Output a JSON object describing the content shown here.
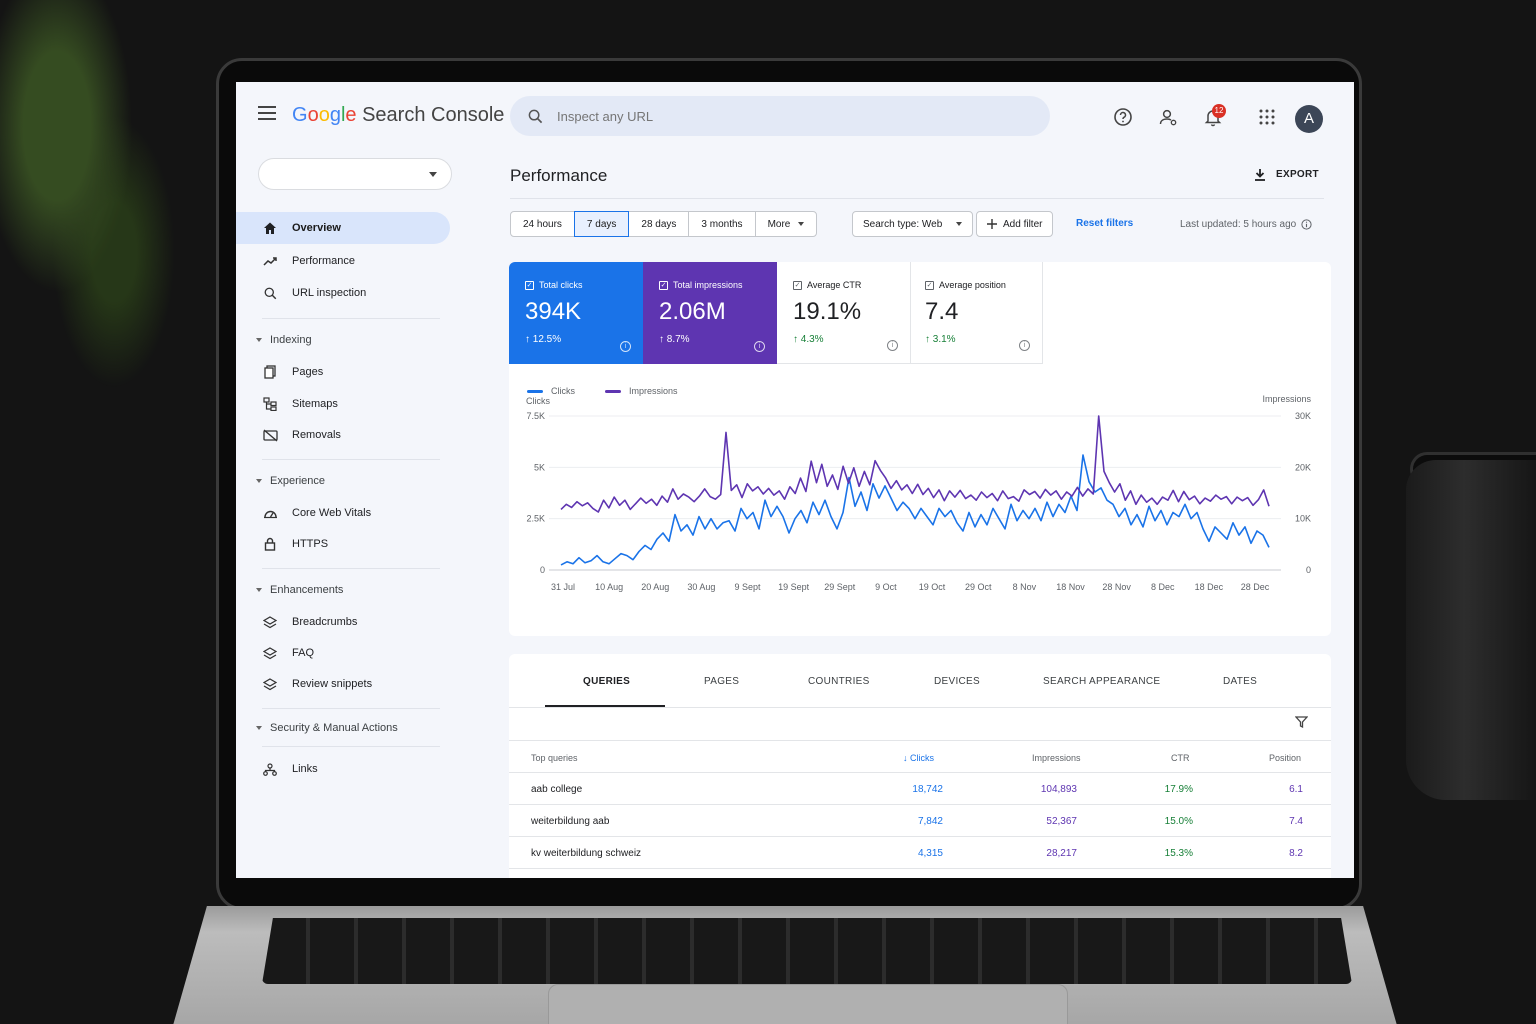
{
  "app": {
    "brand_google": [
      "G",
      "o",
      "o",
      "g",
      "l",
      "e"
    ],
    "brand_product": "Search Console",
    "search_placeholder": "Inspect any URL",
    "notification_count": "12",
    "avatar_letter": "A"
  },
  "sidebar": {
    "items": [
      {
        "label": "Overview",
        "icon": "home-icon",
        "active": true
      },
      {
        "label": "Performance",
        "icon": "trend-icon"
      },
      {
        "label": "URL inspection",
        "icon": "search-icon"
      }
    ],
    "sections": [
      {
        "title": "Indexing",
        "items": [
          {
            "label": "Pages",
            "icon": "pages-icon"
          },
          {
            "label": "Sitemaps",
            "icon": "sitemap-icon"
          },
          {
            "label": "Removals",
            "icon": "removals-icon"
          }
        ]
      },
      {
        "title": "Experience",
        "items": [
          {
            "label": "Core Web Vitals",
            "icon": "gauge-icon"
          },
          {
            "label": "HTTPS",
            "icon": "lock-icon"
          }
        ]
      },
      {
        "title": "Enhancements",
        "items": [
          {
            "label": "Breadcrumbs",
            "icon": "layers-icon"
          },
          {
            "label": "FAQ",
            "icon": "layers-icon"
          },
          {
            "label": "Review snippets",
            "icon": "layers-icon"
          }
        ]
      },
      {
        "title": "Security & Manual Actions",
        "items": []
      }
    ],
    "bottom_items": [
      {
        "label": "Links",
        "icon": "links-icon"
      }
    ]
  },
  "main": {
    "title": "Performance",
    "export_label": "EXPORT",
    "ranges": [
      "24 hours",
      "7 days",
      "28 days",
      "3 months",
      "More"
    ],
    "selected_range": "7 days",
    "search_type_label": "Search type: Web",
    "add_filter_label": "Add filter",
    "reset_filters_label": "Reset filters",
    "last_updated": "Last updated: 5 hours ago"
  },
  "metrics": [
    {
      "label": "Total clicks",
      "value": "394K",
      "delta": "12.5%",
      "color": "#1a73e8",
      "checked": true
    },
    {
      "label": "Total impressions",
      "value": "2.06M",
      "delta": "8.7%",
      "color": "#5e35b1",
      "checked": true
    },
    {
      "label": "Average CTR",
      "value": "19.1%",
      "delta": "4.3%",
      "checked": false
    },
    {
      "label": "Average position",
      "value": "7.4",
      "delta": "3.1%",
      "checked": false
    }
  ],
  "chart_data": {
    "type": "line",
    "legend": [
      "Clicks",
      "Impressions"
    ],
    "ylabel_left": "Clicks",
    "ylabel_right": "Impressions",
    "y_left_ticks": [
      "0",
      "2.5K",
      "5K",
      "7.5K"
    ],
    "y_right_ticks": [
      "0",
      "10K",
      "20K",
      "30K"
    ],
    "y_left_lim": [
      0,
      7500
    ],
    "y_right_lim": [
      0,
      30000
    ],
    "x_ticks": [
      "31 Jul",
      "10 Aug",
      "20 Aug",
      "30 Aug",
      "9 Sept",
      "19 Sept",
      "29 Sept",
      "9 Oct",
      "19 Oct",
      "29 Oct",
      "8 Nov",
      "18 Nov",
      "28 Nov",
      "8 Dec",
      "18 Dec",
      "28 Dec"
    ],
    "series": [
      {
        "name": "Clicks",
        "color": "#1a73e8",
        "values": [
          250,
          400,
          300,
          600,
          350,
          450,
          700,
          400,
          300,
          550,
          800,
          700,
          500,
          900,
          1200,
          1000,
          1500,
          1800,
          1400,
          2700,
          1900,
          2200,
          1700,
          2600,
          2000,
          2500,
          2000,
          2300,
          2400,
          1900,
          3000,
          2500,
          2800,
          2000,
          3400,
          2600,
          3100,
          2600,
          1800,
          2500,
          2900,
          2300,
          3300,
          2700,
          3400,
          2600,
          2000,
          2800,
          4500,
          3100,
          3800,
          2900,
          4200,
          3500,
          4100,
          3500,
          2900,
          3300,
          3000,
          2500,
          3000,
          2600,
          2200,
          3000,
          2600,
          2900,
          2300,
          1900,
          2800,
          2100,
          2700,
          2200,
          3000,
          2500,
          2000,
          3200,
          2400,
          2900,
          2500,
          3000,
          2400,
          3300,
          2600,
          3200,
          2800,
          3600,
          2900,
          5600,
          4300,
          3800,
          4000,
          3400,
          3200,
          2600,
          3000,
          2200,
          2700,
          2100,
          3100,
          2400,
          2900,
          2200,
          2800,
          2600,
          3200,
          2500,
          2800,
          2000,
          1400,
          2100,
          1800,
          1500,
          2300,
          1700,
          2100,
          1300,
          1900,
          1700,
          1100
        ]
      },
      {
        "name": "Impressions",
        "color": "#5e35b1",
        "values": [
          11800,
          12800,
          12200,
          13300,
          12500,
          13100,
          12000,
          11300,
          13600,
          12100,
          14200,
          12600,
          13600,
          11800,
          12900,
          14000,
          13000,
          13800,
          12600,
          14400,
          13200,
          15800,
          13800,
          14800,
          14200,
          13300,
          14400,
          15800,
          14300,
          13800,
          14700,
          26800,
          15500,
          16600,
          14100,
          16800,
          15400,
          16200,
          14800,
          15900,
          14600,
          15400,
          13800,
          16200,
          14900,
          17900,
          15300,
          21200,
          17000,
          20600,
          16300,
          18500,
          15700,
          20200,
          16900,
          19900,
          16300,
          19200,
          16600,
          21300,
          19400,
          17900,
          15900,
          17400,
          15600,
          16600,
          14900,
          16700,
          14700,
          15900,
          14100,
          15600,
          13500,
          15400,
          14200,
          15500,
          13900,
          14600,
          13600,
          15200,
          14100,
          14900,
          13500,
          15400,
          13900,
          14300,
          13400,
          15600,
          14700,
          15300,
          14000,
          15700,
          14600,
          15400,
          13800,
          15200,
          14400,
          16100,
          14400,
          15800,
          14800,
          30000,
          19200,
          17000,
          15200,
          16800,
          13600,
          15400,
          12800,
          14600,
          13200,
          14000,
          12800,
          14200,
          13600,
          15500,
          13300,
          15300,
          13700,
          14400,
          12900,
          14000,
          13400,
          14600,
          13800,
          14300,
          12900,
          14200,
          13500,
          14100,
          12600,
          13700,
          15600,
          12400
        ]
      }
    ]
  },
  "table": {
    "tabs": [
      "QUERIES",
      "PAGES",
      "COUNTRIES",
      "DEVICES",
      "SEARCH APPEARANCE",
      "DATES"
    ],
    "active_tab": "QUERIES",
    "columns": [
      "Top queries",
      "Clicks",
      "Impressions",
      "CTR",
      "Position"
    ],
    "rows": [
      {
        "query": "aab college",
        "clicks": "18,742",
        "impressions": "104,893",
        "ctr": "17.9%",
        "position": "6.1"
      },
      {
        "query": "weiterbildung aab",
        "clicks": "7,842",
        "impressions": "52,367",
        "ctr": "15.0%",
        "position": "7.4"
      },
      {
        "query": "kv weiterbildung schweiz",
        "clicks": "4,315",
        "impressions": "28,217",
        "ctr": "15.3%",
        "position": "8.2"
      }
    ]
  }
}
